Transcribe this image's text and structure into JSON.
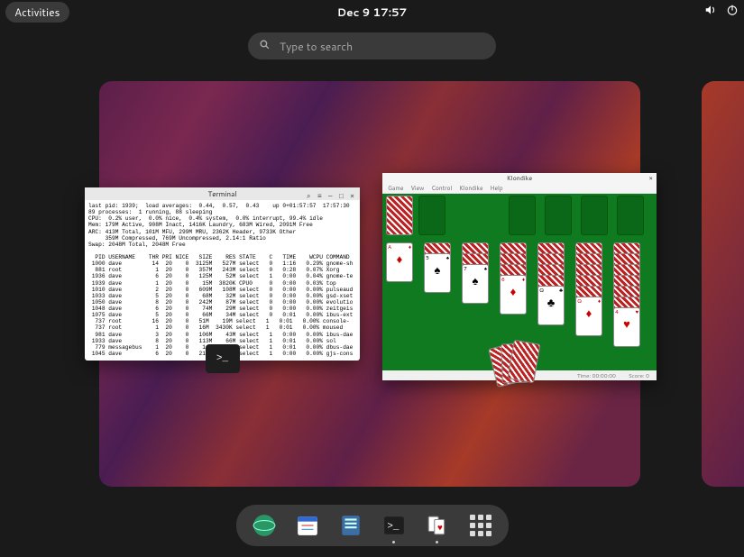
{
  "topbar": {
    "activities": "Activities",
    "clock": "Dec 9  17:57"
  },
  "search": {
    "placeholder": "Type to search"
  },
  "terminal": {
    "title": "Terminal",
    "body_text": "last pid: 1939;  load averages:  0.44,  0.57,  0.43    up 0+01:57:57  17:57:30\n89 processes:  1 running, 88 sleeping\nCPU:  0.2% user,  0.0% nice,  0.4% system,  0.0% interrupt, 99.4% idle\nMem: 179M Active, 908M Inact, 1416K Laundry, 683M Wired, 2091M Free\nARC: 413M Total, 101M MFU, 299M MRU, 2362K Header, 9733K Other\n     359M Compressed, 769M Uncompressed, 2.14:1 Ratio\nSwap: 2048M Total, 2048M Free\n\n  PID USERNAME    THR PRI NICE   SIZE    RES STATE    C   TIME    WCPU COMMAND\n 1000 dave         14  20    0  3125M   527M select   0   1:16   0.29% gnome-sh\n  881 root          1  20    0   357M   243M select   0   0:28   0.07% Xorg\n 1936 dave          6  20    0   125M    52M select   1   0:00   0.04% gnome-te\n 1939 dave          1  20    0    15M  3820K CPU0     0   0:00   0.03% top\n 1010 dave          2  20    0   609M   108M select   0   0:00   0.00% pulseaud\n 1033 dave          5  20    0    68M    32M select   0   0:00   0.00% gsd-xset\n 1050 dave          8  20    0   242M    87M select   0   0:00   0.00% evolutio\n 1048 dave          6  20    0    74M    29M select   0   0:00   0.00% zeitgeis\n 1075 dave          5  20    0    66M    34M select   0   0:01   0.00% ibus-ext\n  737 root         16  20    0   51M    19M select   1   0:01   0.00% console-\n  737 root          1  20    0   16M  3430K select   1   0:01   0.00% moused\n  981 dave          3  20    0   106M    43M select   1   0:00   0.00% ibus-dae\n 1933 dave          8  20    0   113M    66M select   1   0:01   0.00% sol\n  779 messagebus    1  20    0    14M  4868K select   1   0:01   0.00% dbus-dae\n 1045 dave          6  20    0   216M    58M select   1   0:00   0.00% gjs-cons",
    "badge_prompt": ">_"
  },
  "klondike": {
    "title": "Klondike",
    "menu": [
      "Game",
      "View",
      "Control",
      "Klondike",
      "Help"
    ],
    "status": {
      "time": "Time: 00:00:00",
      "score": "Score:  0"
    },
    "tableau": [
      {
        "face": {
          "rank": "A",
          "suit": "♦",
          "red": true
        },
        "hidden": 0
      },
      {
        "face": {
          "rank": "5",
          "suit": "♠",
          "red": false
        },
        "hidden": 1
      },
      {
        "face": {
          "rank": "7",
          "suit": "♠",
          "red": false
        },
        "hidden": 2
      },
      {
        "face": {
          "rank": "6",
          "suit": "♦",
          "red": true
        },
        "hidden": 3
      },
      {
        "face": {
          "rank": "Q",
          "suit": "♣",
          "red": false
        },
        "hidden": 4
      },
      {
        "face": {
          "rank": "Q",
          "suit": "♦",
          "red": true
        },
        "hidden": 5
      },
      {
        "face": {
          "rank": "4",
          "suit": "♥",
          "red": true
        },
        "hidden": 6
      }
    ]
  },
  "dash": {
    "items": [
      {
        "name": "web-browser",
        "indicator": false
      },
      {
        "name": "calendar",
        "indicator": false
      },
      {
        "name": "files",
        "indicator": false
      },
      {
        "name": "terminal",
        "indicator": true
      },
      {
        "name": "solitaire",
        "indicator": true
      },
      {
        "name": "app-grid",
        "indicator": false
      }
    ]
  }
}
